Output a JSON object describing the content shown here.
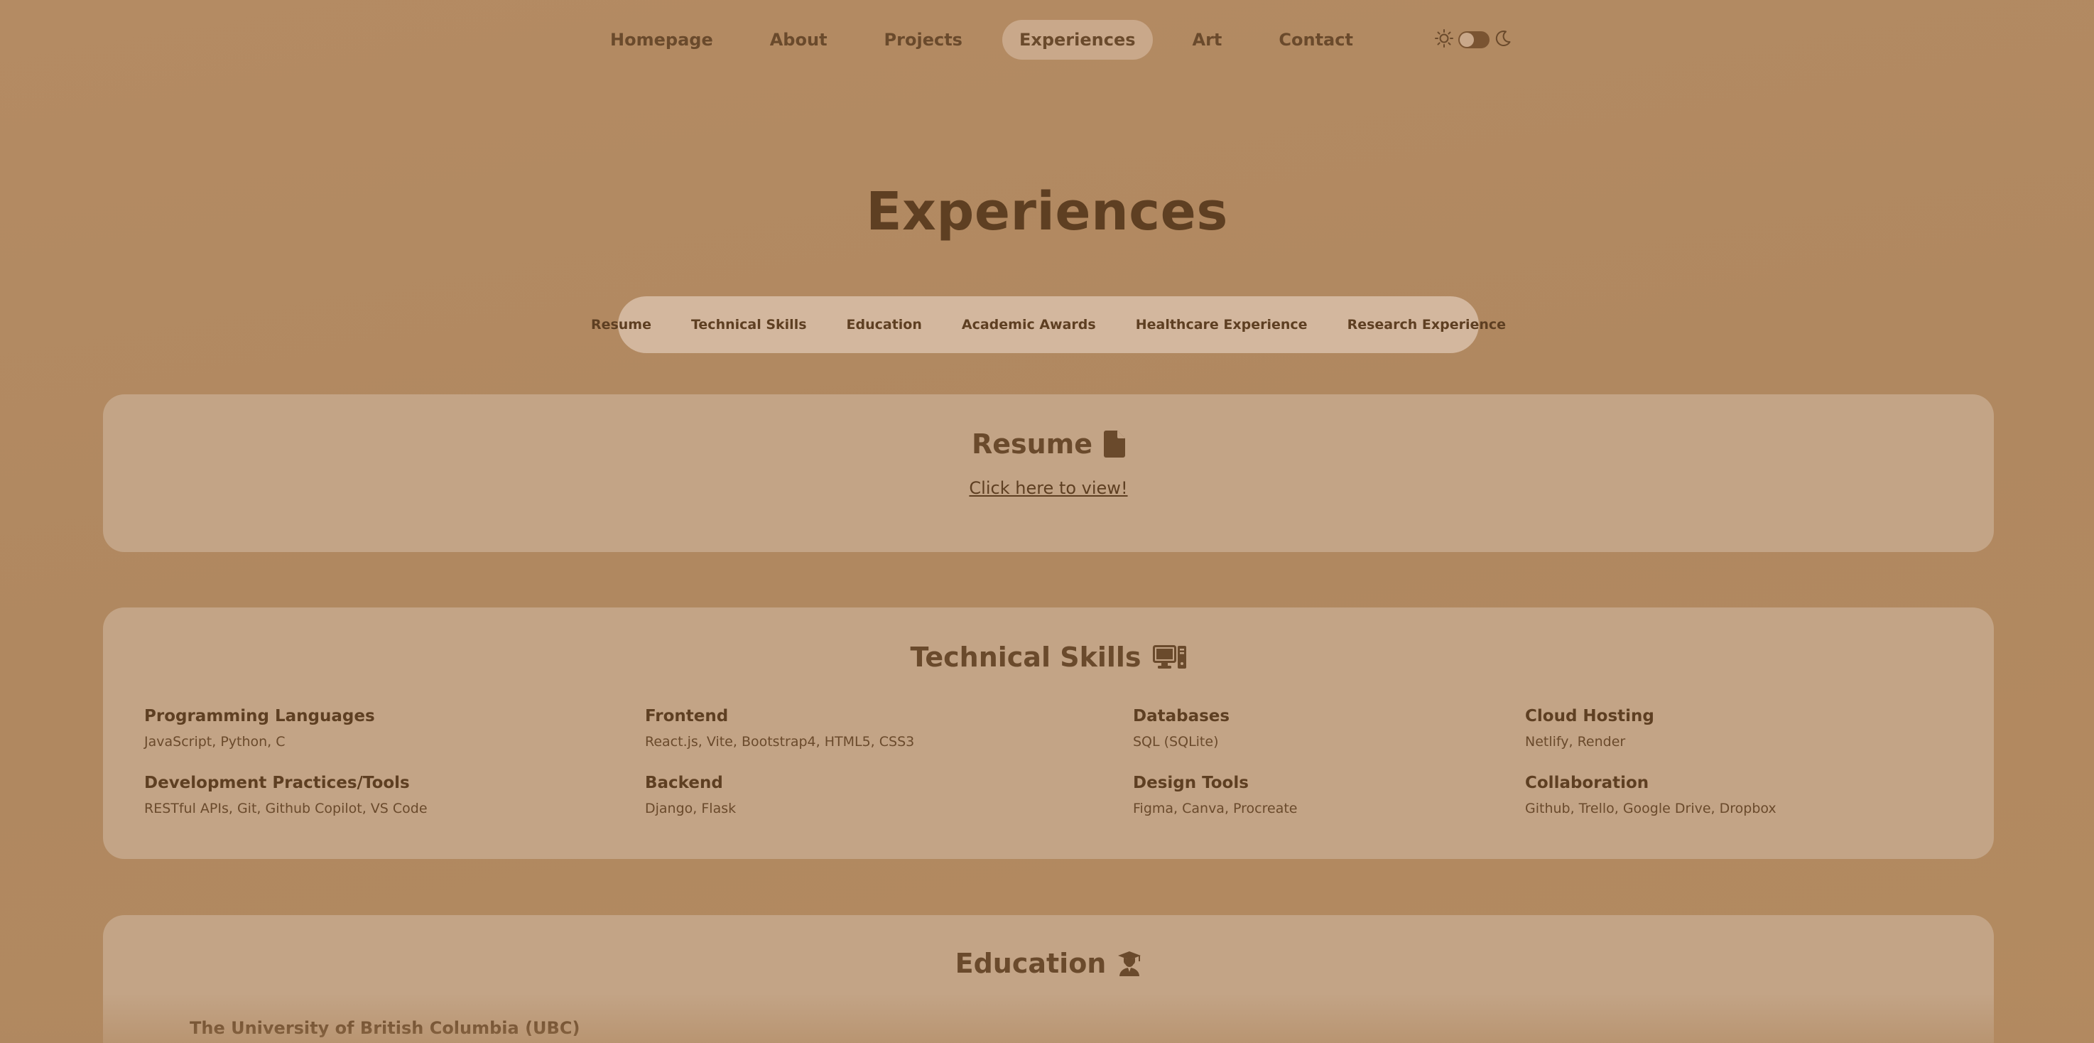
{
  "nav": {
    "items": [
      {
        "label": "Homepage"
      },
      {
        "label": "About"
      },
      {
        "label": "Projects"
      },
      {
        "label": "Experiences",
        "active": true
      },
      {
        "label": "Art"
      },
      {
        "label": "Contact"
      }
    ],
    "theme_icons": [
      "sun-icon",
      "moon-icon"
    ]
  },
  "page": {
    "title": "Experiences"
  },
  "subnav": {
    "items": [
      {
        "label": "Resume"
      },
      {
        "label": "Technical Skills"
      },
      {
        "label": "Education"
      },
      {
        "label": "Academic Awards"
      },
      {
        "label": "Healthcare Experience"
      },
      {
        "label": "Research Experience"
      }
    ]
  },
  "resume": {
    "title": "Resume",
    "icon": "file-icon",
    "link_label": "Click here to view!"
  },
  "skills": {
    "title": "Technical Skills",
    "icon": "computer-icon",
    "items": [
      {
        "name": "Programming Languages",
        "value": "JavaScript, Python, C"
      },
      {
        "name": "Frontend",
        "value": "React.js, Vite, Bootstrap4, HTML5, CSS3"
      },
      {
        "name": "Databases",
        "value": "SQL (SQLite)"
      },
      {
        "name": "Cloud Hosting",
        "value": "Netlify, Render"
      },
      {
        "name": "Development Practices/Tools",
        "value": "RESTful APIs, Git, Github Copilot, VS Code"
      },
      {
        "name": "Backend",
        "value": "Django, Flask"
      },
      {
        "name": "Design Tools",
        "value": "Figma, Canva, Procreate"
      },
      {
        "name": "Collaboration",
        "value": "Github, Trello, Google Drive, Dropbox"
      }
    ]
  },
  "education": {
    "title": "Education",
    "icon": "graduate-icon",
    "school": "The University of British Columbia (UBC)"
  },
  "colors": {
    "background": "#b08860",
    "card": "#c3a486",
    "pill": "#d3b79e",
    "text": "#5e3f22"
  }
}
